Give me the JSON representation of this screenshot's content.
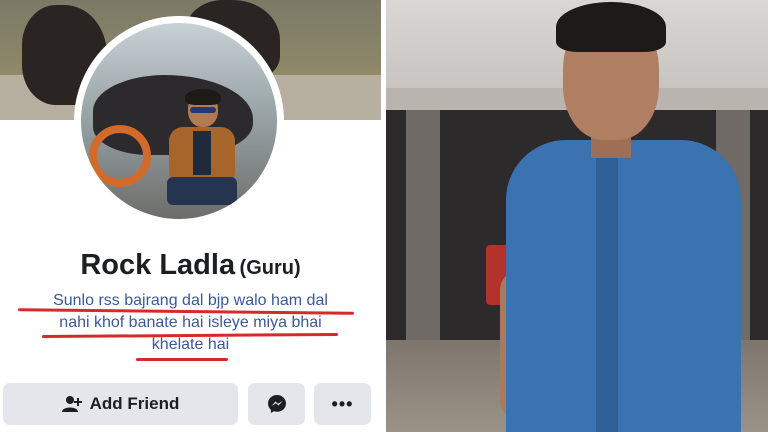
{
  "profile": {
    "name": "Rock Ladla",
    "alt_name": "(Guru)",
    "bio_lines": [
      "Sunlo rss bajrang dal bjp walo ham dal",
      "nahi khof banate hai isleye miya bhai",
      "khelate hai"
    ]
  },
  "actions": {
    "add_friend_label": "Add Friend",
    "add_friend_icon": "add-friend-icon",
    "messenger_icon": "messenger-icon",
    "more_label": "•••"
  },
  "colors": {
    "button_bg": "#e4e6eb",
    "bio_text": "#3b5998",
    "underline": "#d42a2a",
    "name_text": "#1c1e21"
  }
}
